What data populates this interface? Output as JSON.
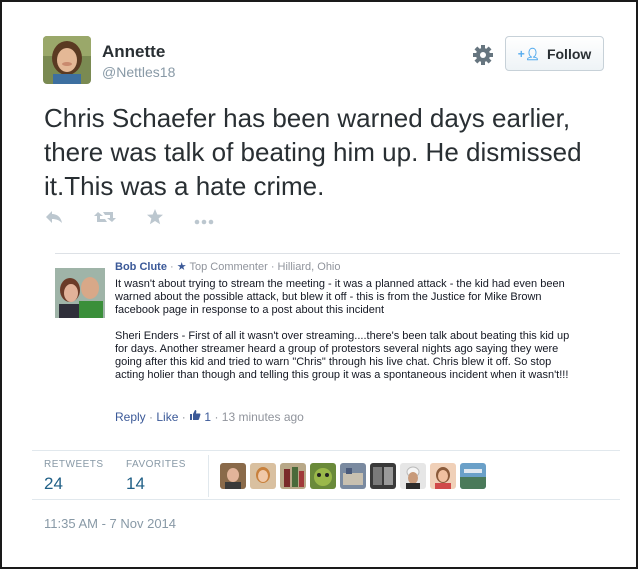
{
  "user": {
    "name": "Annette",
    "handle": "@Nettles18"
  },
  "follow_button": {
    "label": "Follow"
  },
  "tweet": {
    "text": "Chris Schaefer has been warned days earlier, there was talk of beating him up. He dismissed it.This was a hate crime."
  },
  "actions": {
    "reply_icon": "reply-icon",
    "retweet_icon": "retweet-icon",
    "favorite_icon": "star-icon",
    "more_icon": "more-icon"
  },
  "comment": {
    "author": "Bob Clute",
    "separator": "·",
    "badge": "Top Commenter",
    "location": "· Hilliard, Ohio",
    "paragraph1": "It wasn't about trying to stream the meeting - it was a planned attack - the kid had even been warned about the possible attack, but blew it off - this is from the Justice for Mike Brown facebook page in response to a post about this incident",
    "paragraph2": "Sheri Enders - First of all it wasn't over streaming....there's been talk about beating this kid up for days. Another streamer heard a group of protestors several nights ago saying they were going after this kid and tried to warn \"Chris\" through his live chat. Chris blew it off. So stop acting holier than though and telling this group it was a spontaneous incident when it wasn't!!!",
    "reply_label": "Reply",
    "like_label": "Like",
    "dot": "·",
    "like_count": "1",
    "time": "· 13 minutes ago"
  },
  "stats": {
    "retweets_label": "RETWEETS",
    "retweets_count": "24",
    "favorites_label": "FAVORITES",
    "favorites_count": "14"
  },
  "favoriters_count": 10,
  "timestamp": "11:35 AM - 7 Nov 2014",
  "colors": {
    "link": "#3b5998",
    "count": "#1f5f86",
    "muted": "#8899a6",
    "follow_icon": "#55acee"
  }
}
